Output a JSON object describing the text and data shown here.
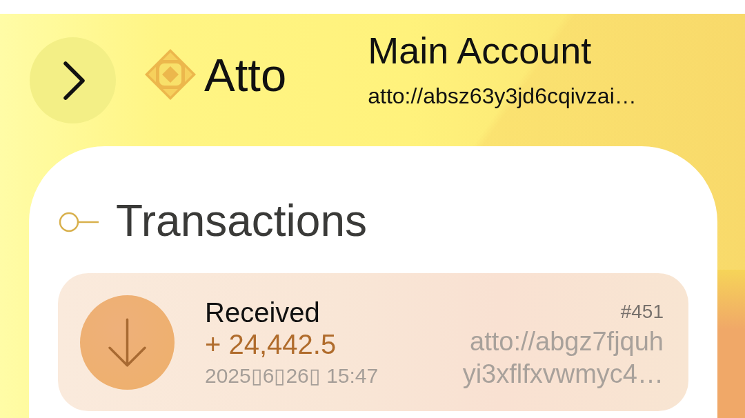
{
  "header": {
    "app_name": "Atto"
  },
  "account": {
    "name": "Main Account",
    "address": "atto://absz63y3jd6cqivzai…"
  },
  "transactions": {
    "title": "Transactions",
    "items": [
      {
        "kind": "received",
        "label": "Received",
        "amount": "+ 24,442.5",
        "timestamp": "2025▯6▯26▯ 15:47",
        "number": "#451",
        "address_lines": [
          "atto://abgz7fjquh",
          "yi3xflfxvwmyc4…"
        ]
      }
    ]
  }
}
